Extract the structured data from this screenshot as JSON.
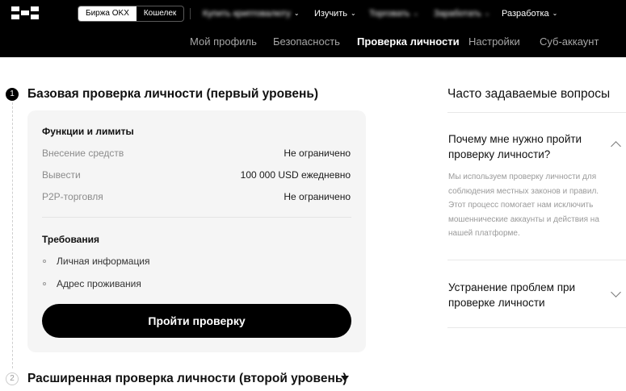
{
  "header": {
    "exchange_tab": "Биржа OKX",
    "wallet_tab": "Кошелек",
    "nav": {
      "buy_crypto": "Купить криптовалюту",
      "learn": "Изучить",
      "trade": "Торговать",
      "earn": "Заработать",
      "develop": "Разработка"
    },
    "subnav": {
      "profile": "Мой профиль",
      "security": "Безопасность",
      "verification": "Проверка личности",
      "settings": "Настройки",
      "subaccount": "Суб-аккаунт"
    }
  },
  "level1": {
    "step_number": "1",
    "title": "Базовая проверка личности (первый уровень)",
    "features_heading": "Функции и лимиты",
    "rows": [
      {
        "label": "Внесение средств",
        "value": "Не ограничено"
      },
      {
        "label": "Вывести",
        "value": "100 000 USD ежедневно"
      },
      {
        "label": "P2P-торговля",
        "value": "Не ограничено"
      }
    ],
    "requirements_heading": "Требования",
    "requirements": [
      "Личная информация",
      "Адрес проживания"
    ],
    "button_label": "Пройти проверку"
  },
  "level2": {
    "step_number": "2",
    "title": "Расширенная проверка личности (второй уровень)"
  },
  "faq": {
    "title": "Часто задаваемые вопросы",
    "items": [
      {
        "question": "Почему мне нужно пройти проверку личности?",
        "answer": "Мы используем проверку личности для соблюдения местных законов и правил. Этот процесс помогает нам исключить мошеннические аккаунты и действия на нашей платформе."
      },
      {
        "question": "Устранение проблем при проверке личности"
      }
    ]
  },
  "icons": {
    "logo": "okx-logo",
    "chevron": "chevron-down-icon",
    "expand": "triangle-down-icon"
  }
}
